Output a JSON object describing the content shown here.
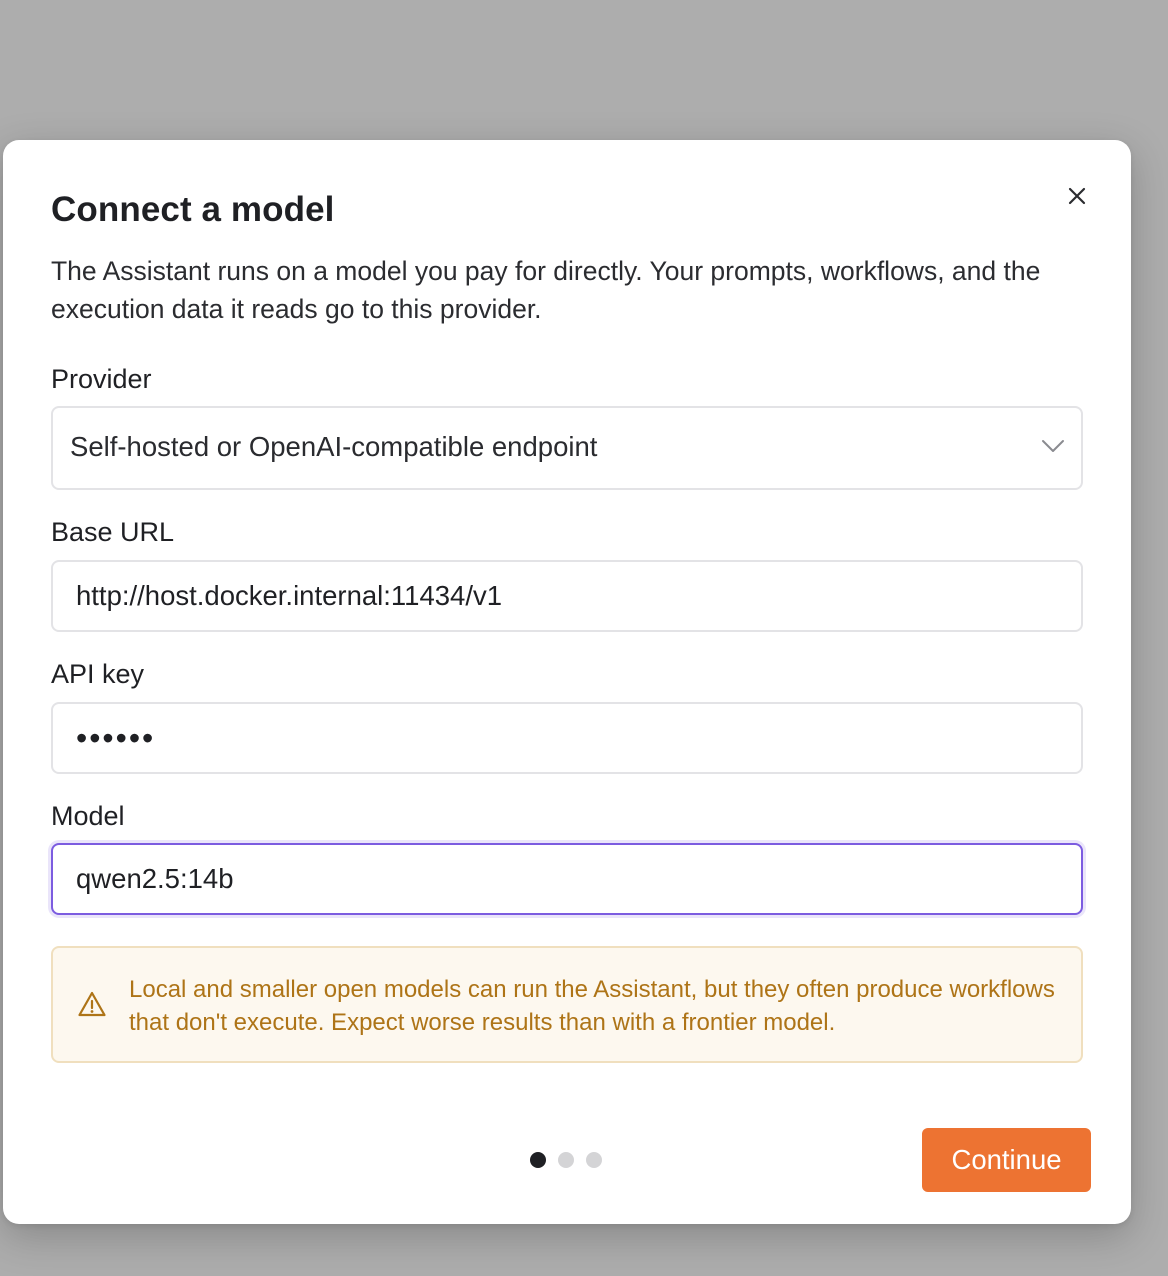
{
  "modal": {
    "title": "Connect a model",
    "description": "The Assistant runs on a model you pay for directly. Your prompts, workflows, and the execution data it reads go to this provider.",
    "close_icon": "close-icon"
  },
  "form": {
    "provider": {
      "label": "Provider",
      "value": "Self-hosted or OpenAI-compatible endpoint",
      "icon": "chevron-down-icon"
    },
    "base_url": {
      "label": "Base URL",
      "value": "http://host.docker.internal:11434/v1"
    },
    "api_key": {
      "label": "API key",
      "value": "••••••"
    },
    "model": {
      "label": "Model",
      "value": "qwen2.5:14b",
      "focused": true
    }
  },
  "warning": {
    "icon": "warning-triangle-icon",
    "text": "Local and smaller open models can run the Assistant, but they often produce workflows that don't execute. Expect worse results than with a frontier model."
  },
  "stepper": {
    "total_steps": 3,
    "current_step": 1
  },
  "footer": {
    "continue_label": "Continue"
  },
  "colors": {
    "backdrop": "#adadad",
    "accent": "#ed7332",
    "focus_ring": "#7c5ce0",
    "warning_text": "#ae7417",
    "warning_bg": "#fdf8ef",
    "warning_border": "#f0dfbe"
  }
}
